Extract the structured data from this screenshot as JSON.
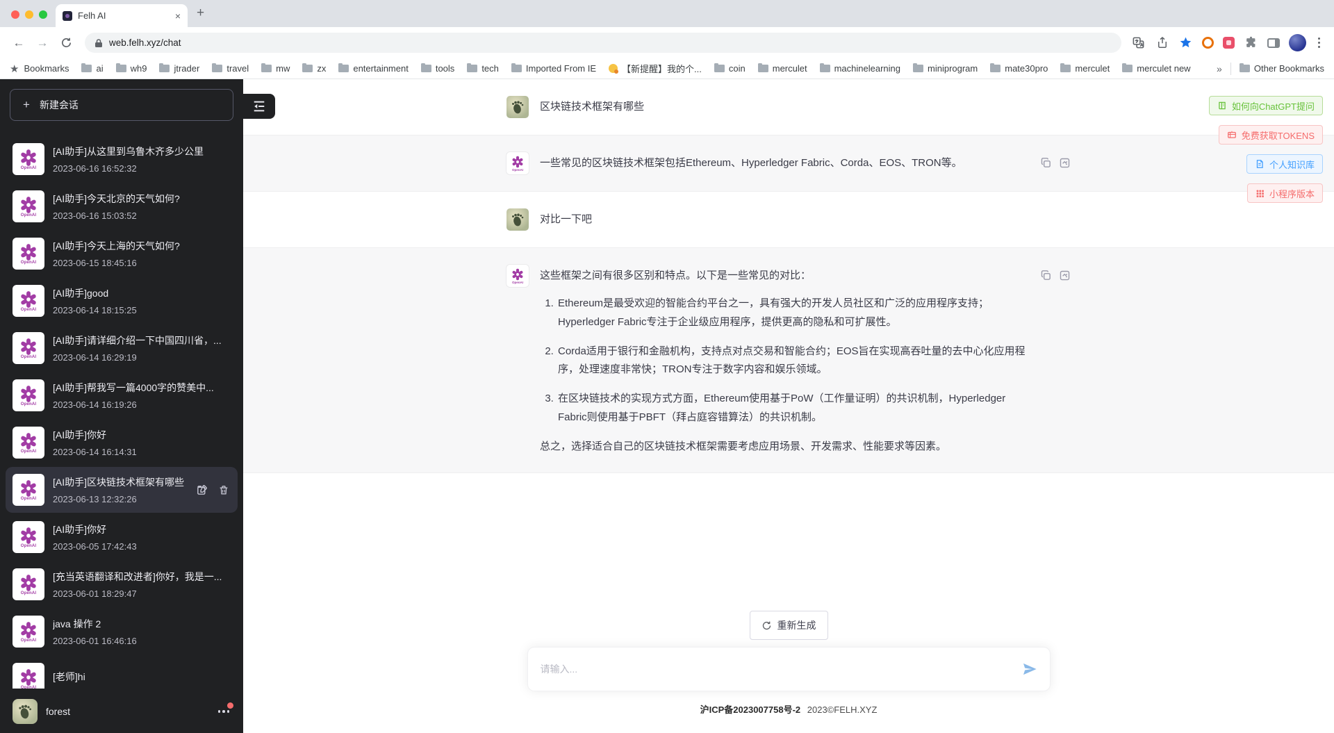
{
  "browser": {
    "tab_title": "Felh AI",
    "url": "web.felh.xyz/chat",
    "icons": {
      "close_tab": "×",
      "new_tab": "+",
      "back": "←",
      "forward": "→"
    },
    "bookmarks_bar": {
      "bookmarks_label": "Bookmarks",
      "other_bookmarks_label": "Other Bookmarks",
      "overflow_chevron": "»",
      "folders": [
        {
          "label": "ai"
        },
        {
          "label": "wh9"
        },
        {
          "label": "jtrader"
        },
        {
          "label": "travel"
        },
        {
          "label": "mw"
        },
        {
          "label": "zx"
        },
        {
          "label": "entertainment"
        },
        {
          "label": "tools"
        },
        {
          "label": "tech"
        },
        {
          "label": "Imported From IE"
        },
        {
          "label": "【新提醒】我的个...",
          "icon": "medal"
        },
        {
          "label": "coin"
        },
        {
          "label": "merculet"
        },
        {
          "label": "machinelearning"
        },
        {
          "label": "miniprogram"
        },
        {
          "label": "mate30pro"
        },
        {
          "label": "merculet"
        },
        {
          "label": "merculet new"
        }
      ]
    }
  },
  "sidebar": {
    "new_chat_label": "新建会话",
    "openai_wordmark": "OpenAI",
    "conversations": [
      {
        "title": "[AI助手]从这里到乌鲁木齐多少公里",
        "time": "2023-06-16 16:52:32"
      },
      {
        "title": "[AI助手]今天北京的天气如何?",
        "time": "2023-06-16 15:03:52"
      },
      {
        "title": "[AI助手]今天上海的天气如何?",
        "time": "2023-06-15 18:45:16"
      },
      {
        "title": "[AI助手]good",
        "time": "2023-06-14 18:15:25"
      },
      {
        "title": "[AI助手]请详细介绍一下中国四川省，...",
        "time": "2023-06-14 16:29:19"
      },
      {
        "title": "[AI助手]帮我写一篇4000字的赞美中...",
        "time": "2023-06-14 16:19:26"
      },
      {
        "title": "[AI助手]你好",
        "time": "2023-06-14 16:14:31"
      },
      {
        "title": "[AI助手]区块链技术框架有哪些",
        "time": "2023-06-13 12:32:26",
        "active": true
      },
      {
        "title": "[AI助手]你好",
        "time": "2023-06-05 17:42:43"
      },
      {
        "title": "[充当英语翻译和改进者]你好，我是一...",
        "time": "2023-06-01 18:29:47"
      },
      {
        "title": "java 操作 2",
        "time": "2023-06-01 16:46:16"
      },
      {
        "title": "[老师]hi",
        "time": ""
      }
    ],
    "user_name": "forest"
  },
  "chat": {
    "messages": {
      "q1": "区块链技术框架有哪些",
      "a1": "一些常见的区块链技术框架包括Ethereum、Hyperledger Fabric、Corda、EOS、TRON等。",
      "q2": "对比一下吧",
      "a2_intro": "这些框架之间有很多区别和特点。以下是一些常见的对比：",
      "a2_items": [
        {
          "text": "Ethereum是最受欢迎的智能合约平台之一，具有强大的开发人员社区和广泛的应用程序支持；Hyperledger Fabric专注于企业级应用程序，提供更高的隐私和可扩展性。"
        },
        {
          "text": "Corda适用于银行和金融机构，支持点对点交易和智能合约；EOS旨在实现高吞吐量的去中心化应用程序，处理速度非常快；TRON专注于数字内容和娱乐领域。"
        },
        {
          "text": "在区块链技术的实现方式方面，Ethereum使用基于PoW（工作量证明）的共识机制，Hyperledger Fabric则使用基于PBFT（拜占庭容错算法）的共识机制。"
        }
      ],
      "a2_outro": "总之，选择适合自己的区块链技术框架需要考虑应用场景、开发需求、性能要求等因素。"
    },
    "regenerate_label": "重新生成",
    "input_placeholder": "请输入...",
    "footer_icp": "沪ICP备2023007758号-2",
    "footer_copyright": "2023©FELH.XYZ"
  },
  "quick_actions": [
    {
      "label": "如何向ChatGPT提问",
      "color": "green",
      "icon": "book-icon"
    },
    {
      "label": "免费获取TOKENS",
      "color": "red",
      "icon": "ticket-icon"
    },
    {
      "label": "个人知识库",
      "color": "blue",
      "icon": "document-icon"
    },
    {
      "label": "小程序版本",
      "color": "red",
      "icon": "grid-icon"
    }
  ],
  "colors": {
    "sidebar_bg": "#202123",
    "assistant_row_bg": "#f7f7f8",
    "success_green": "#67c23a",
    "danger_red": "#f56c6c",
    "primary_blue": "#409eff",
    "send_icon_blue": "#8ab9e8",
    "openai_logo_purple": "#a23ca5"
  }
}
